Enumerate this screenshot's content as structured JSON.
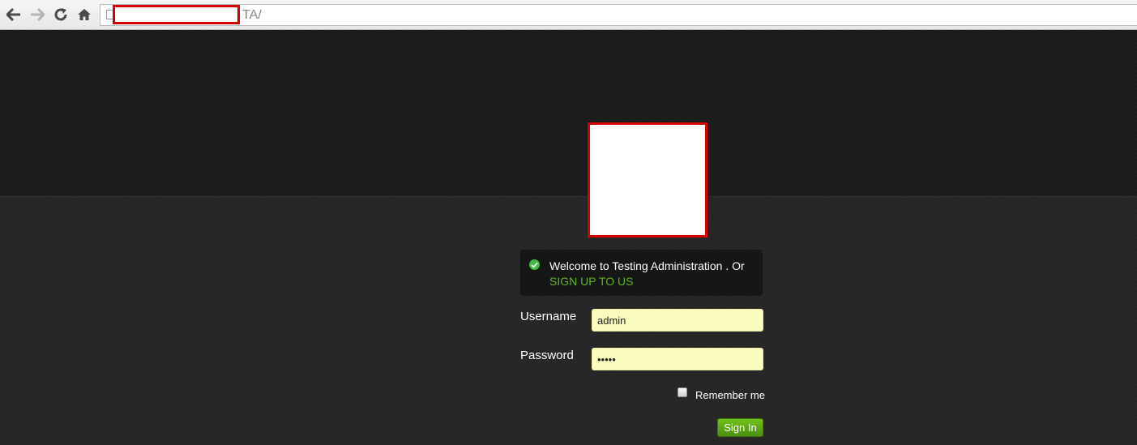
{
  "browser": {
    "url_suffix": "TA/"
  },
  "welcome": {
    "message": "Welcome to Testing Administration . Or",
    "signup_link": "SIGN UP TO US"
  },
  "form": {
    "username_label": "Username",
    "username_value": "admin",
    "password_label": "Password",
    "password_value": "admin",
    "remember_label": "Remember me",
    "remember_checked": false,
    "signin_label": "Sign In"
  },
  "colors": {
    "accent_green": "#5fb520",
    "input_bg": "#fbfdbf",
    "redaction_red": "#d40000"
  },
  "icons": [
    "back-arrow-icon",
    "forward-arrow-icon",
    "reload-icon",
    "home-icon",
    "page-icon",
    "check-circle-icon"
  ]
}
